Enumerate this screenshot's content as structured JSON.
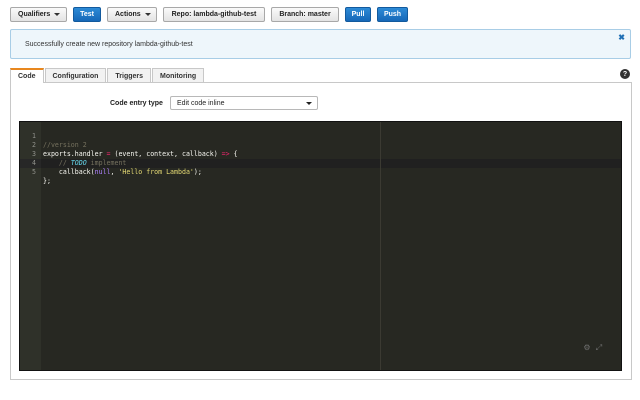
{
  "toolbar": {
    "qualifiers": "Qualifiers",
    "test": "Test",
    "actions": "Actions",
    "repo": "Repo: lambda-github-test",
    "branch": "Branch: master",
    "pull": "Pull",
    "push": "Push"
  },
  "alert": {
    "message": "Successfully create new repository lambda-github-test",
    "close_icon": "close-icon"
  },
  "tabs": [
    "Code",
    "Configuration",
    "Triggers",
    "Monitoring"
  ],
  "active_tab": "Code",
  "code_entry": {
    "label": "Code entry type",
    "selected": "Edit code inline"
  },
  "editor": {
    "line_numbers": [
      "1",
      "2",
      "3",
      "4",
      "5"
    ],
    "line1": "//version 2",
    "line2_a": "exports.handler ",
    "line2_op1": "=",
    "line2_b": " (event, context, callback) ",
    "line2_op2": "=>",
    "line2_c": " {",
    "line3_a": "    // ",
    "line3_todo": "TODO",
    "line3_b": " implement",
    "line4_a": "    callback(",
    "line4_null": "null",
    "line4_b": ", ",
    "line4_str": "'Hello from Lambda'",
    "line4_c": ");",
    "line5": "};"
  },
  "colors": {
    "primary_button": "#1f77c9",
    "tab_accent": "#e8871e",
    "editor_bg": "#272822"
  }
}
